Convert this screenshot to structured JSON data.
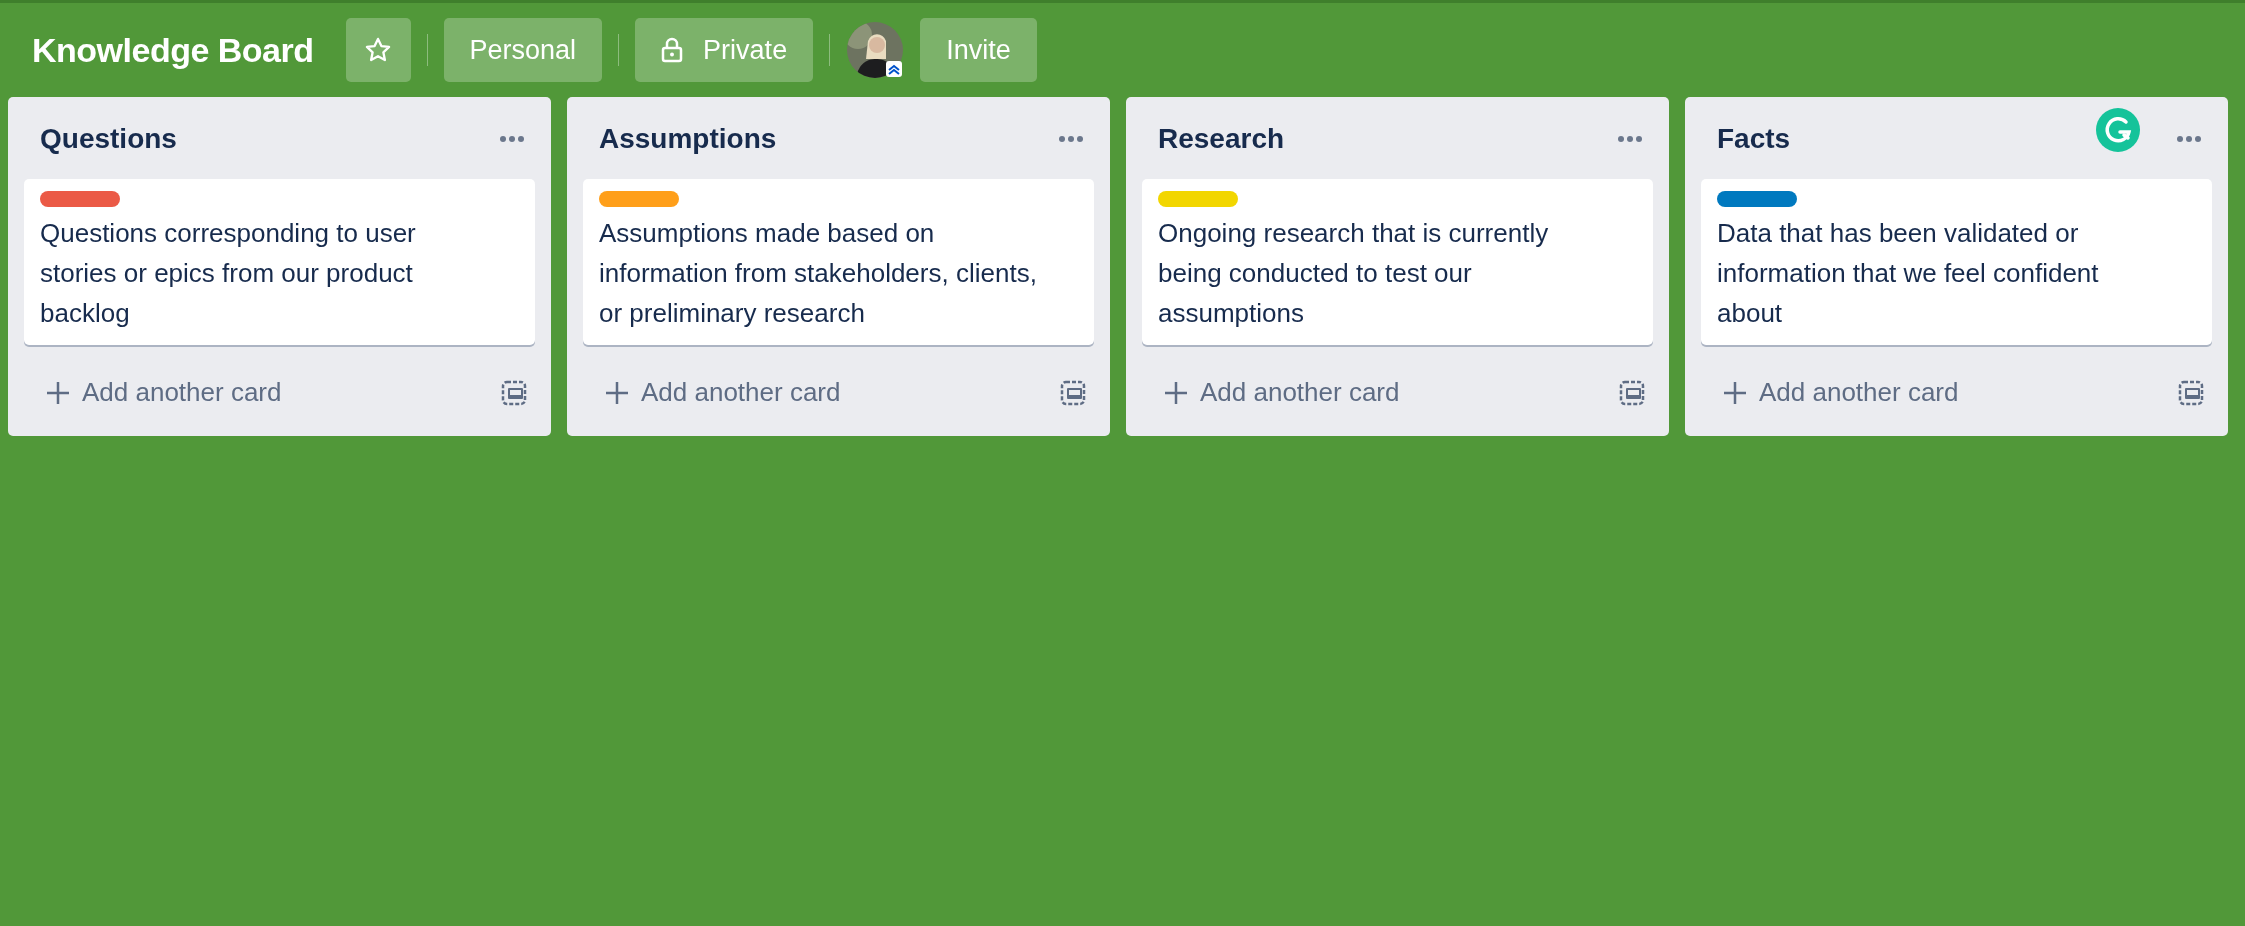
{
  "board": {
    "title": "Knowledge Board",
    "starred": false,
    "visibility_team": "Personal",
    "visibility": "Private",
    "invite": "Invite"
  },
  "lists": [
    {
      "title": "Questions",
      "cards": [
        {
          "color": "#eb5a46",
          "text": "Questions corresponding to user stories or epics from our product backlog"
        }
      ],
      "add_card": "Add another card"
    },
    {
      "title": "Assumptions",
      "cards": [
        {
          "color": "#ff9f1a",
          "text": "Assumptions made based on information from stakeholders, clients, or preliminary research"
        }
      ],
      "add_card": "Add another card"
    },
    {
      "title": "Research",
      "cards": [
        {
          "color": "#f2d600",
          "text": "Ongoing research that is currently being conducted to test our assumptions"
        }
      ],
      "add_card": "Add another card"
    },
    {
      "title": "Facts",
      "cards": [
        {
          "color": "#0079bf",
          "text": "Data that has been validated or information that we feel confident about"
        }
      ],
      "add_card": "Add another card"
    }
  ]
}
